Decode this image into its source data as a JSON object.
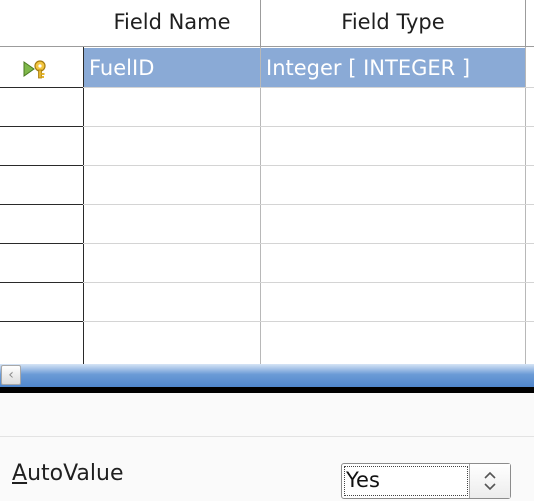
{
  "table": {
    "columns": [
      "Field Name",
      "Field Type"
    ],
    "rows": [
      {
        "field_name": "FuelID",
        "field_type": "Integer [ INTEGER ]",
        "primary_key": true,
        "selected": true
      }
    ]
  },
  "properties": {
    "autovalue_label_accel": "A",
    "autovalue_label_rest": "utoValue",
    "autovalue_value": "Yes"
  },
  "icons": {
    "row_indicator": "primary-key-cursor-icon",
    "scroll_left": "scroll-left-arrow-icon",
    "spinner": "spin-up-down-icon"
  },
  "colors": {
    "selection": "#8aaad6",
    "scrollbar": "#4f86cc"
  }
}
